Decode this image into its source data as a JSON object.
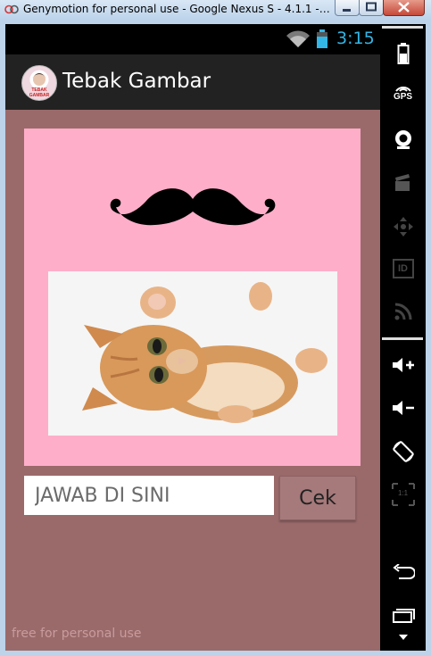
{
  "window": {
    "title": "Genymotion for personal use - Google Nexus S - 4.1.1 - API 16 ..."
  },
  "statusbar": {
    "time": "3:15"
  },
  "actionbar": {
    "title": "Tebak Gambar",
    "logo_text": "TEBAK GAMBAR"
  },
  "quiz": {
    "answer_placeholder": "JAWAB DI SINI",
    "check_label": "Cek"
  },
  "watermark": "free for personal use",
  "sidebar": {
    "gps_label": "GPS",
    "id_label": "ID",
    "scale_label": "1:1"
  },
  "colors": {
    "screen_bg": "#9a6a6b",
    "card_bg": "#ffaeca",
    "accent_time": "#33b5e5"
  }
}
